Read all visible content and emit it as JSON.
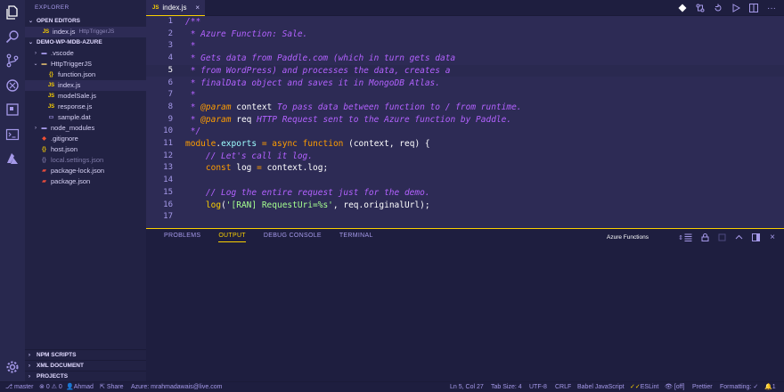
{
  "sidebar": {
    "title": "EXPLORER",
    "open_editors": {
      "label": "OPEN EDITORS",
      "files": [
        {
          "icon": "JS",
          "name": "index.js",
          "path": "HttpTriggerJS"
        }
      ]
    },
    "project": {
      "label": "DEMO-WP-MDB-AZURE",
      "tree": [
        {
          "caret": "›",
          "icon": "folder",
          "name": ".vscode"
        },
        {
          "caret": "⌄",
          "icon": "folder",
          "name": "HttpTriggerJS"
        },
        {
          "icon": "{}",
          "name": "function.json"
        },
        {
          "icon": "JS",
          "name": "index.js"
        },
        {
          "icon": "JS",
          "name": "modelSale.js"
        },
        {
          "icon": "JS",
          "name": "response.js"
        },
        {
          "icon": "file",
          "name": "sample.dat"
        },
        {
          "caret": "›",
          "icon": "folder",
          "name": "node_modules"
        },
        {
          "icon": "git",
          "name": ".gitignore"
        },
        {
          "icon": "{}",
          "name": "host.json"
        },
        {
          "icon": "{}",
          "name": "local.settings.json"
        },
        {
          "icon": "npm",
          "name": "package-lock.json"
        },
        {
          "icon": "npm",
          "name": "package.json"
        }
      ]
    },
    "bottom_sections": [
      "NPM SCRIPTS",
      "XML DOCUMENT",
      "PROJECTS"
    ]
  },
  "editor": {
    "tab": {
      "icon": "JS",
      "label": "index.js",
      "close": "×"
    },
    "lines": [
      {
        "n": "1",
        "t": [
          [
            "c",
            "/**"
          ]
        ]
      },
      {
        "n": "2",
        "t": [
          [
            "c",
            " * Azure Function: Sale."
          ]
        ]
      },
      {
        "n": "3",
        "t": [
          [
            "c",
            " *"
          ]
        ]
      },
      {
        "n": "4",
        "t": [
          [
            "c",
            " * Gets data from Paddle.com (which in turn gets data"
          ]
        ]
      },
      {
        "n": "5",
        "t": [
          [
            "c",
            " * from WordPress) and processes the data, creates a"
          ]
        ]
      },
      {
        "n": "6",
        "t": [
          [
            "c",
            " * finalData object and saves it in MongoDB Atlas."
          ]
        ]
      },
      {
        "n": "7",
        "t": [
          [
            "c",
            " *"
          ]
        ]
      },
      {
        "n": "8",
        "t": [
          [
            "c",
            " * "
          ],
          [
            "tag",
            "@param"
          ],
          [
            "var",
            " context"
          ],
          [
            "c",
            " To pass data between function to / from runtime."
          ]
        ]
      },
      {
        "n": "9",
        "t": [
          [
            "c",
            " * "
          ],
          [
            "tag",
            "@param"
          ],
          [
            "var",
            " req"
          ],
          [
            "c",
            " HTTP Request sent to the Azure function by Paddle."
          ]
        ]
      },
      {
        "n": "10",
        "t": [
          [
            "c",
            " */"
          ]
        ]
      },
      {
        "n": "11",
        "t": [
          [
            "kw",
            "module"
          ],
          [
            "plain",
            "."
          ],
          [
            "prop",
            "exports"
          ],
          [
            "kw",
            " = "
          ],
          [
            "kw",
            "async"
          ],
          [
            "plain",
            " "
          ],
          [
            "kw",
            "function"
          ],
          [
            "plain",
            " (context, req) {"
          ]
        ]
      },
      {
        "n": "12",
        "t": [
          [
            "guide",
            "    "
          ],
          [
            "c",
            "// Let's call it log."
          ]
        ]
      },
      {
        "n": "13",
        "t": [
          [
            "guide",
            "    "
          ],
          [
            "kw",
            "const"
          ],
          [
            "plain",
            " log "
          ],
          [
            "kw",
            "="
          ],
          [
            "plain",
            " context.log;"
          ]
        ]
      },
      {
        "n": "14",
        "t": [
          [
            "plain",
            ""
          ]
        ]
      },
      {
        "n": "15",
        "t": [
          [
            "guide",
            "    "
          ],
          [
            "c",
            "// Log the entire request just for the demo."
          ]
        ]
      },
      {
        "n": "16",
        "t": [
          [
            "guide",
            "    "
          ],
          [
            "fn",
            "log"
          ],
          [
            "plain",
            "("
          ],
          [
            "str",
            "'[RAN] RequestUri=%s'"
          ],
          [
            "plain",
            ", req.originalUrl);"
          ]
        ]
      },
      {
        "n": "17",
        "t": [
          [
            "plain",
            ""
          ]
        ]
      }
    ],
    "current_line": "5"
  },
  "panel": {
    "tabs": [
      "PROBLEMS",
      "OUTPUT",
      "DEBUG CONSOLE",
      "TERMINAL"
    ],
    "active_tab": "OUTPUT",
    "select_value": "Azure Functions",
    "select_arrow": "⇕"
  },
  "status": {
    "branch": "master",
    "problems": "0",
    "warnings": "0",
    "user": "Ahmad",
    "share": "Share",
    "azure": "Azure: mrahmadawais@live.com",
    "position": "Ln 5, Col 27",
    "tab_size": "Tab Size: 4",
    "encoding": "UTF-8",
    "eol": "CRLF",
    "language": "Babel JavaScript",
    "eslint": "ESLint",
    "eye": "[off]",
    "prettier": "Prettier",
    "formatting": "Formatting: ✓",
    "notifications": "1"
  },
  "colors": {
    "accent": "#fad000",
    "background": "#2d2b55",
    "comment": "#b362ff",
    "keyword": "#ff9d00"
  }
}
